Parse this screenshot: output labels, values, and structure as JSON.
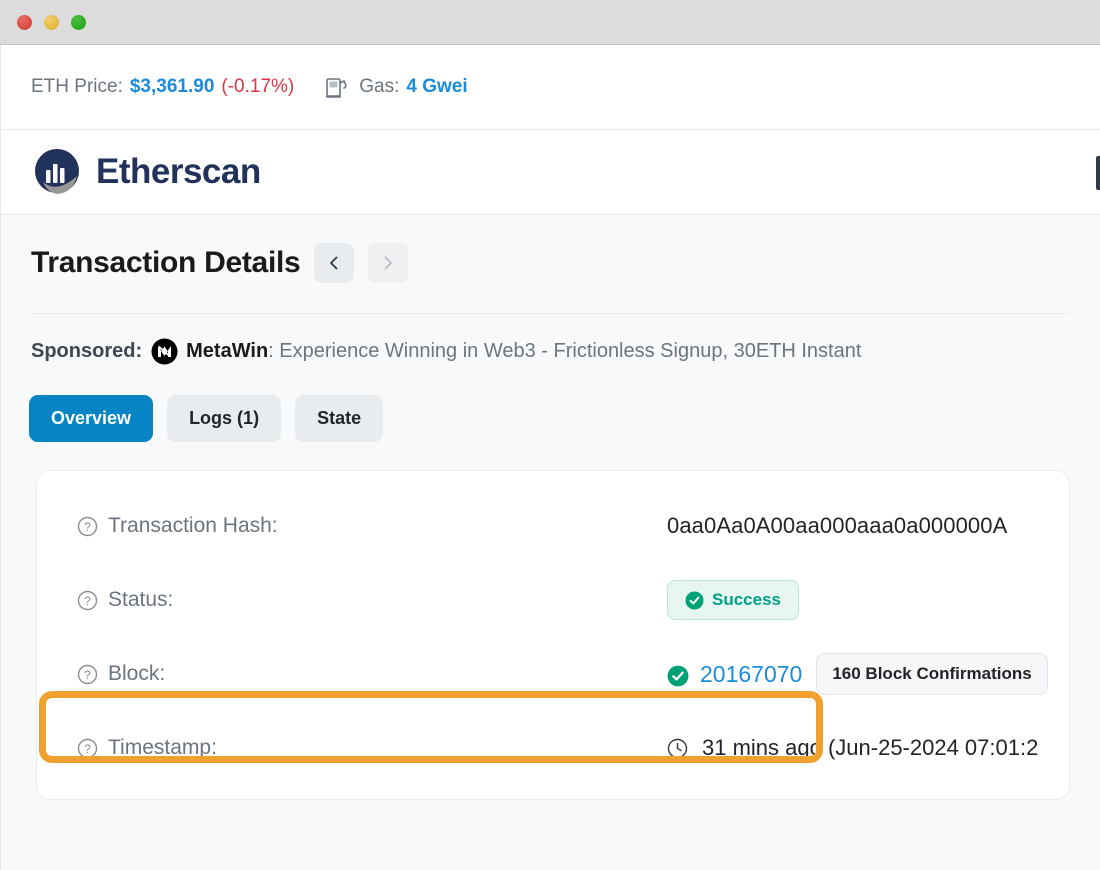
{
  "window": {
    "traffic_lights": [
      "close",
      "minimize",
      "zoom"
    ]
  },
  "topbar": {
    "eth_price_label": "ETH Price:",
    "eth_price_value": "$3,361.90",
    "eth_price_change": "(-0.17%)",
    "gas_icon": "gas-pump-icon",
    "gas_label": "Gas:",
    "gas_value": "4 Gwei"
  },
  "header": {
    "logo_icon": "etherscan-logo-icon",
    "brand": "Etherscan"
  },
  "title_section": {
    "title": "Transaction Details",
    "prev_icon": "chevron-left-icon",
    "next_icon": "chevron-right-icon"
  },
  "sponsored": {
    "label": "Sponsored:",
    "advertiser_icon": "metawin-logo-icon",
    "advertiser": "MetaWin",
    "text": ": Experience Winning in Web3 - Frictionless Signup, 30ETH Instant"
  },
  "tabs": [
    {
      "label": "Overview",
      "active": true
    },
    {
      "label": "Logs (1)",
      "active": false
    },
    {
      "label": "State",
      "active": false
    }
  ],
  "details": {
    "rows": [
      {
        "label": "Transaction Hash:",
        "value": "0aa0Aa0A00aa000aaa0a000000A"
      },
      {
        "label": "Status:",
        "status_badge": "Success",
        "status_icon": "check-circle-icon"
      },
      {
        "label": "Block:",
        "block_icon": "check-circle-icon",
        "block_number": "20167070",
        "confirmations": "160 Block Confirmations"
      },
      {
        "label": "Timestamp:",
        "time_icon": "clock-icon",
        "timestamp": "31 mins ago (Jun-25-2024 07:01:2"
      }
    ],
    "help_icon": "question-circle-icon"
  },
  "annotation": {
    "highlight_target": "status-row",
    "color": "#efa02f"
  },
  "colors": {
    "accent_blue": "#0784c3",
    "link_blue": "#1a8cdb",
    "success_green": "#00a186",
    "danger_red": "#dc3545",
    "brand_navy": "#21325b",
    "highlight_orange": "#efa02f"
  }
}
